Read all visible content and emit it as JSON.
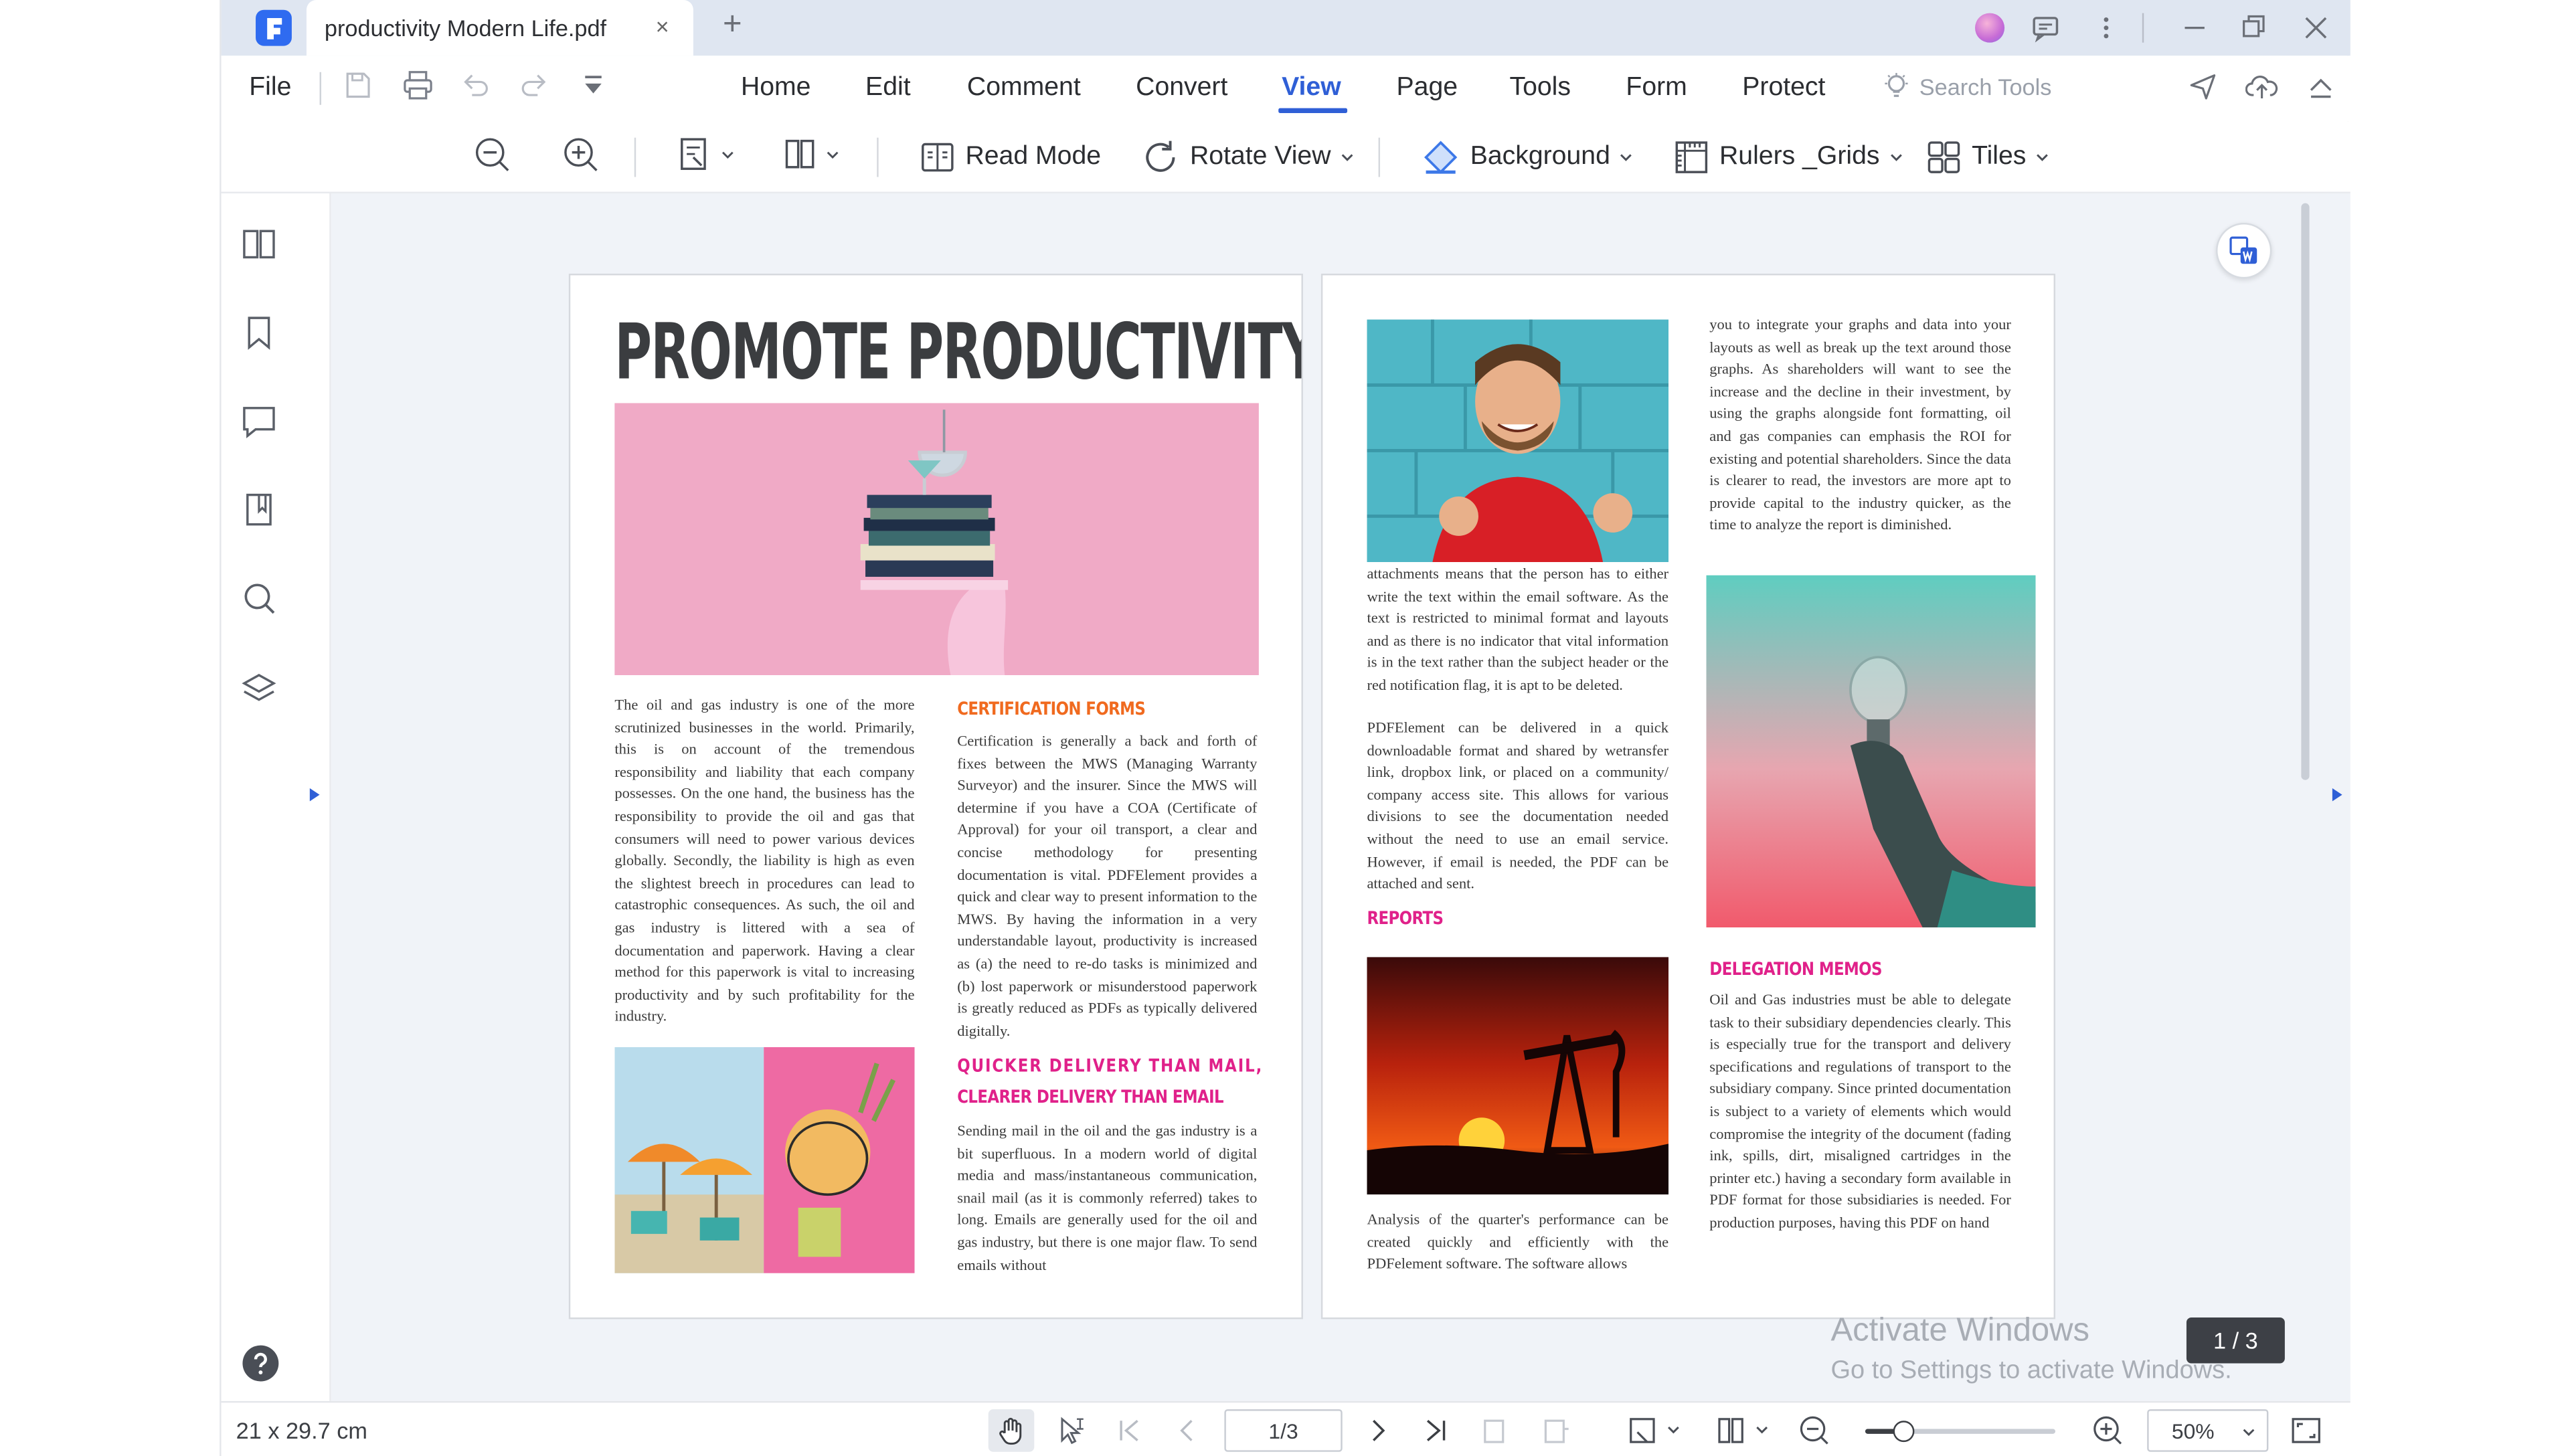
{
  "app": {
    "tab_title": "productivity Modern Life.pdf",
    "tab_close": "×",
    "new_tab": "+"
  },
  "menu": {
    "file": "File",
    "items": [
      "Home",
      "Edit",
      "Comment",
      "Convert",
      "View",
      "Page",
      "Tools",
      "Form",
      "Protect"
    ],
    "active": "View",
    "search_tools": "Search Tools"
  },
  "toolbar": {
    "read_mode": "Read Mode",
    "rotate_view": "Rotate View",
    "background": "Background",
    "rulers_grids": "Rulers _Grids",
    "tiles": "Tiles"
  },
  "document": {
    "page1": {
      "headline": "PROMOTE PRODUCTIVITY",
      "col1_text": "The oil and gas industry is one of the more scrutinized businesses in the world. Primarily, this is on account of the tremendous responsibility and liability that each company possesses. On the one hand, the business has the responsibility to provide the oil and gas that consumers will need to power various devices globally. Secondly, the liability is high as even the slightest breech in procedures can lead to catastrophic consequences. As such, the oil and gas industry is littered with a sea of documentation and paperwork. Having a clear method for this paperwork is vital to increasing productivity and by such profitability for the industry.",
      "cert_heading": "CERTIFICATION FORMS",
      "cert_text": "Certification is generally a back and forth of fixes between the MWS (Managing Warranty Surveyor) and the insurer. Since the MWS will determine if you have a COA (Certificate of Approval) for your oil transport, a clear and concise methodology for presenting documentation is vital. PDFElement provides a quick and clear way to present information to the MWS. By having the information in a very understandable layout, productivity is increased as (a) the need to re-do tasks is minimized and (b) lost paperwork or misunderstood paperwork is greatly reduced as PDFs as typically delivered digitally.",
      "quicker_heading_1": "QUICKER DELIVERY THAN MAIL,",
      "quicker_heading_2": "CLEARER DELIVERY THAN EMAIL",
      "quicker_text": "Sending mail in the oil and the gas industry is a bit superfluous. In a modern world of digital media and mass/instantaneous communication, snail mail (as it is commonly referred) takes to long. Emails are generally used for the oil and gas industry, but there is one major flaw. To send emails without"
    },
    "page2": {
      "top_right_text": "you to integrate your graphs and data into your layouts as well as break up the text around those graphs. As shareholders will want to see the increase and the decline in their investment, by using the graphs alongside font formatting, oil and gas companies can emphasis the ROI for existing and potential shareholders. Since the data is clearer to read, the investors are more apt to provide capital to the industry quicker, as the time to analyze the report is diminished.",
      "left_text": "attachments means that the person has to either write the text within the email software. As the text is restricted to minimal format and layouts and as there is no indicator that vital information is in the text rather than the subject header or the red notification flag, it is apt to be deleted.",
      "left_text_2": "PDFElement can be delivered in a quick downloadable format and shared by wetransfer link, dropbox link, or placed on a community/ company access site. This allows for various divisions to see the documentation needed without the need to use an email service. However, if email is needed, the PDF can be attached and sent.",
      "reports_heading": "REPORTS",
      "reports_text": "Analysis of the quarter's performance can be created quickly and efficiently with the PDFelement software. The software allows",
      "delegation_heading": "DELEGATION MEMOS",
      "delegation_text": "Oil and Gas industries must be able to delegate task to their subsidiary dependencies clearly. This is especially true for the transport and delivery specifications and regulations of transport to the subsidiary company. Since printed documentation is subject to a variety of elements which would compromise the integrity of the document (fading ink, spills, dirt, misaligned cartridges in the printer etc.) having a secondary form available in PDF format for those subsidiaries is needed. For production purposes, having this PDF on hand"
    }
  },
  "overlay": {
    "page_badge": "1 / 3",
    "activate_title": "Activate Windows",
    "activate_sub": "Go to Settings to activate Windows."
  },
  "status": {
    "page_size": "21 x 29.7 cm",
    "page_input": "1/3",
    "zoom": "50%",
    "zoom_level": 0.2
  },
  "colors": {
    "accent": "#2f5fd6",
    "heading_orange": "#f06a1f",
    "heading_pink": "#e0218a",
    "canvas_bg": "#f0f3f8"
  }
}
